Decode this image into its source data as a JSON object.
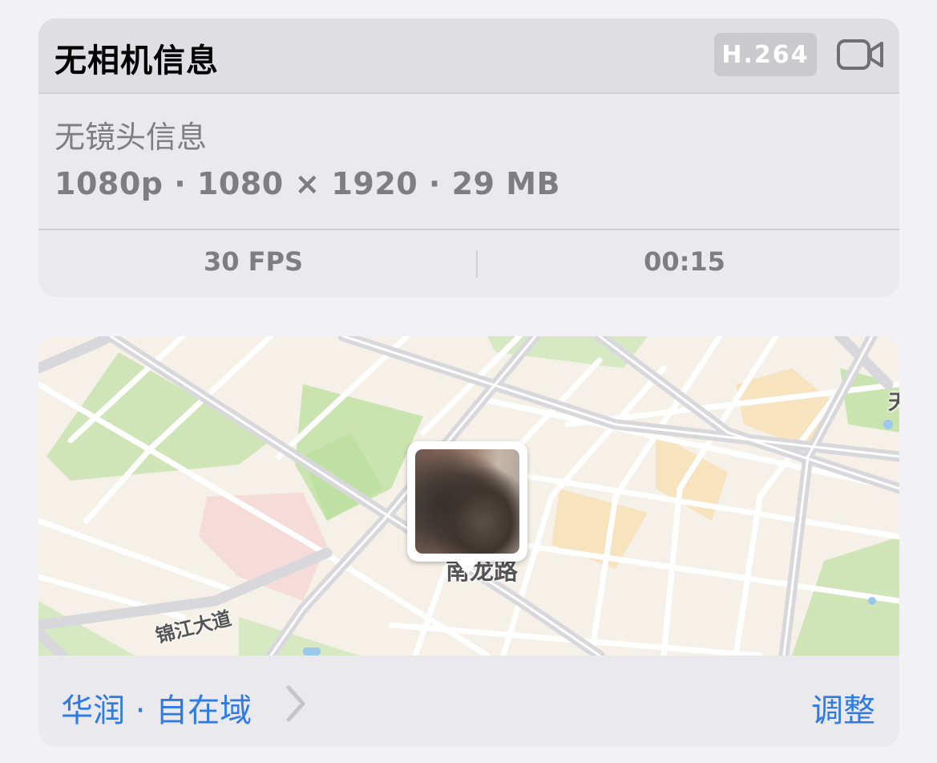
{
  "info": {
    "camera_title": "无相机信息",
    "codec": "H.264",
    "lens": "无镜头信息",
    "resolution": "1080p",
    "dimensions": "1080 × 1920",
    "file_size": "29 MB",
    "separator": " · ",
    "fps": "30 FPS",
    "duration": "00:15"
  },
  "map": {
    "road_labels": [
      "南龙路",
      "锦江大道",
      "天"
    ],
    "location": "华润 · 自在域",
    "adjust_label": "调整"
  },
  "colors": {
    "accent": "#2f7ae6",
    "secondary_text": "#7d7d82",
    "card_bg": "#e9e9ee",
    "page_bg": "#f2f2f6"
  },
  "icons": [
    "video-camera-icon",
    "chevron-right-icon"
  ]
}
